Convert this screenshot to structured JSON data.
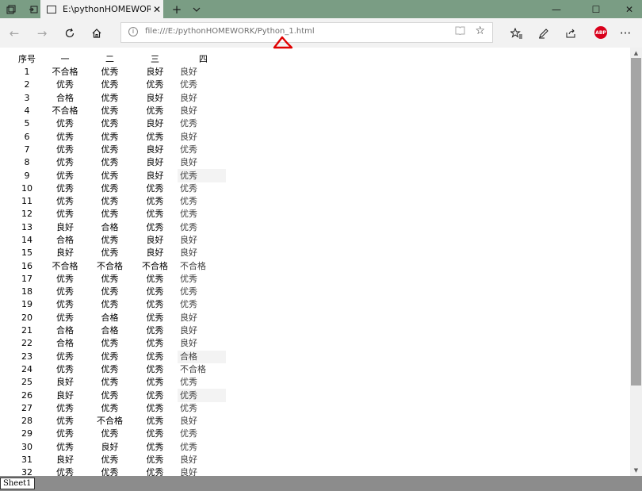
{
  "browser": {
    "tab_title": "E:\\pythonHOMEWORK\\",
    "tab_close": "✕",
    "new_tab": "+",
    "url": "file:///E:/pythonHOMEWORK/Python_1.html",
    "abp_badge": "ABP",
    "window_minimize": "—",
    "window_maximize": "☐",
    "window_close": "✕",
    "more": "···"
  },
  "table": {
    "headers": [
      "序号",
      "一",
      "二",
      "三",
      "四"
    ],
    "rows": [
      [
        "1",
        "不合格",
        "优秀",
        "良好",
        "良好"
      ],
      [
        "2",
        "优秀",
        "优秀",
        "优秀",
        "优秀"
      ],
      [
        "3",
        "合格",
        "优秀",
        "良好",
        "良好"
      ],
      [
        "4",
        "不合格",
        "优秀",
        "优秀",
        "良好"
      ],
      [
        "5",
        "优秀",
        "优秀",
        "良好",
        "优秀"
      ],
      [
        "6",
        "优秀",
        "优秀",
        "优秀",
        "良好"
      ],
      [
        "7",
        "优秀",
        "优秀",
        "良好",
        "优秀"
      ],
      [
        "8",
        "优秀",
        "优秀",
        "良好",
        "良好"
      ],
      [
        "9",
        "优秀",
        "优秀",
        "良好",
        "优秀"
      ],
      [
        "10",
        "优秀",
        "优秀",
        "优秀",
        "优秀"
      ],
      [
        "11",
        "优秀",
        "优秀",
        "优秀",
        "优秀"
      ],
      [
        "12",
        "优秀",
        "优秀",
        "优秀",
        "优秀"
      ],
      [
        "13",
        "良好",
        "合格",
        "优秀",
        "优秀"
      ],
      [
        "14",
        "合格",
        "优秀",
        "良好",
        "良好"
      ],
      [
        "15",
        "良好",
        "优秀",
        "良好",
        "良好"
      ],
      [
        "16",
        "不合格",
        "不合格",
        "不合格",
        "不合格"
      ],
      [
        "17",
        "优秀",
        "优秀",
        "优秀",
        "优秀"
      ],
      [
        "18",
        "优秀",
        "优秀",
        "优秀",
        "优秀"
      ],
      [
        "19",
        "优秀",
        "优秀",
        "优秀",
        "优秀"
      ],
      [
        "20",
        "优秀",
        "合格",
        "优秀",
        "良好"
      ],
      [
        "21",
        "合格",
        "合格",
        "优秀",
        "良好"
      ],
      [
        "22",
        "合格",
        "优秀",
        "优秀",
        "良好"
      ],
      [
        "23",
        "优秀",
        "优秀",
        "优秀",
        "合格"
      ],
      [
        "24",
        "优秀",
        "优秀",
        "优秀",
        "不合格"
      ],
      [
        "25",
        "良好",
        "优秀",
        "优秀",
        "优秀"
      ],
      [
        "26",
        "良好",
        "优秀",
        "优秀",
        "优秀"
      ],
      [
        "27",
        "优秀",
        "优秀",
        "优秀",
        "优秀"
      ],
      [
        "28",
        "优秀",
        "不合格",
        "优秀",
        "良好"
      ],
      [
        "29",
        "优秀",
        "优秀",
        "优秀",
        "优秀"
      ],
      [
        "30",
        "优秀",
        "良好",
        "优秀",
        "优秀"
      ],
      [
        "31",
        "良好",
        "优秀",
        "优秀",
        "良好"
      ],
      [
        "32",
        "优秀",
        "优秀",
        "优秀",
        "良好"
      ]
    ],
    "highlighted_rows": [
      9,
      23,
      26
    ]
  },
  "sheet_tab": "Sheet1",
  "colors": {
    "tabbar": "#7a9d84",
    "annotation": "#e00000"
  }
}
